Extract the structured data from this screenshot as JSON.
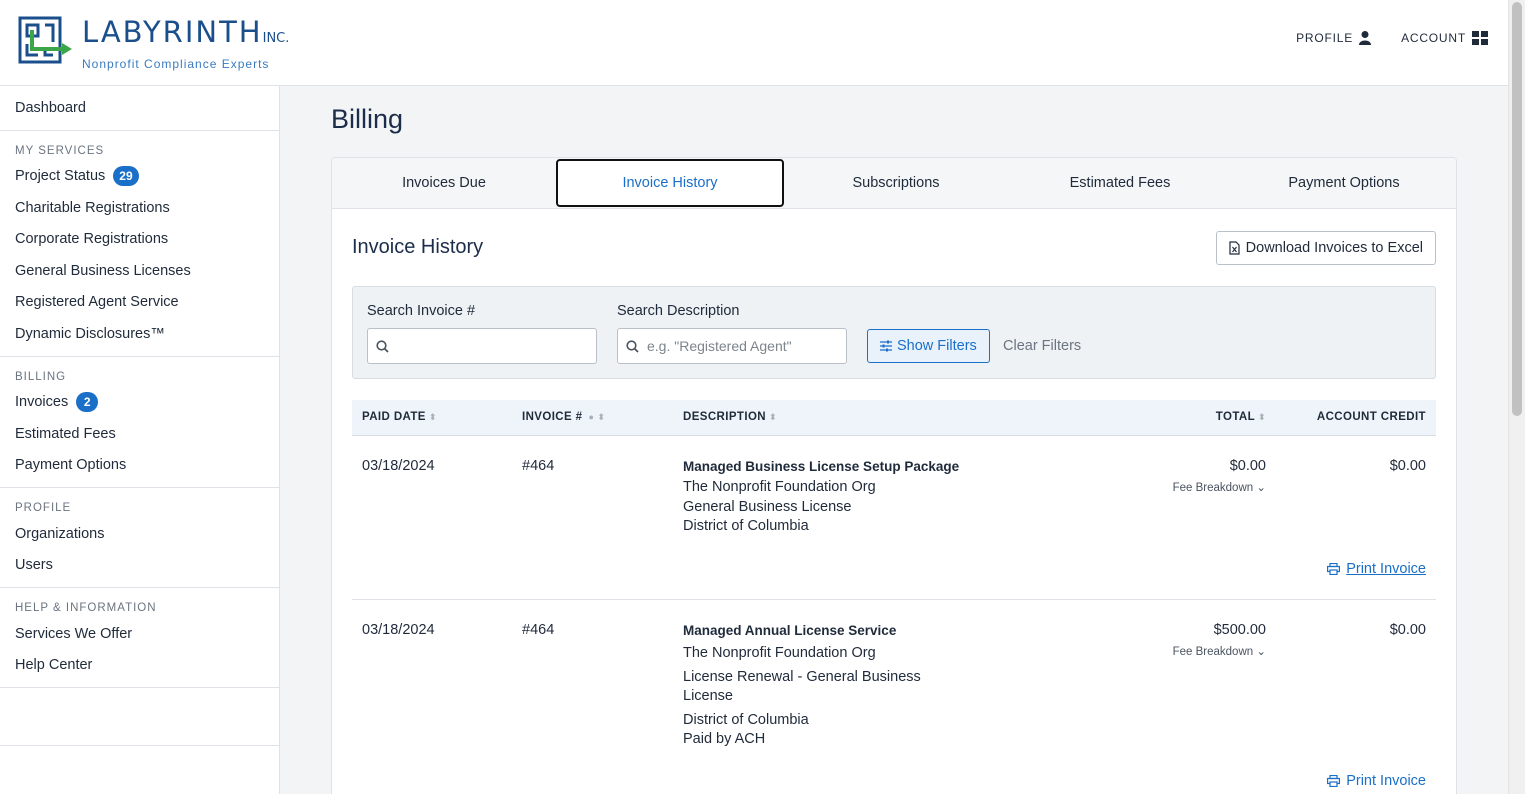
{
  "brand": {
    "name": "LABYRINTH",
    "suffix": "INC.",
    "tagline": "Nonprofit Compliance Experts",
    "colors": {
      "primary": "#1b4f8c",
      "accent": "#3a7bbf",
      "green": "#3ba54a"
    }
  },
  "header": {
    "profile_label": "PROFILE",
    "account_label": "ACCOUNT"
  },
  "sidebar": {
    "dashboard": "Dashboard",
    "sections": [
      {
        "heading": "MY SERVICES",
        "items": [
          {
            "label": "Project Status",
            "badge": "29"
          },
          {
            "label": "Charitable Registrations"
          },
          {
            "label": "Corporate Registrations"
          },
          {
            "label": "General Business Licenses"
          },
          {
            "label": "Registered Agent Service"
          },
          {
            "label": "Dynamic Disclosures™"
          }
        ]
      },
      {
        "heading": "BILLING",
        "items": [
          {
            "label": "Invoices",
            "badge": "2"
          },
          {
            "label": "Estimated Fees"
          },
          {
            "label": "Payment Options"
          }
        ]
      },
      {
        "heading": "PROFILE",
        "items": [
          {
            "label": "Organizations"
          },
          {
            "label": "Users"
          }
        ]
      },
      {
        "heading": "HELP & INFORMATION",
        "items": [
          {
            "label": "Services We Offer"
          },
          {
            "label": "Help Center"
          }
        ]
      }
    ]
  },
  "main": {
    "title": "Billing",
    "tabs": [
      {
        "label": "Invoices Due"
      },
      {
        "label": "Invoice History",
        "active": true
      },
      {
        "label": "Subscriptions"
      },
      {
        "label": "Estimated Fees"
      },
      {
        "label": "Payment Options"
      }
    ],
    "section_title": "Invoice History",
    "download_label": "Download Invoices to Excel",
    "filters": {
      "invoice_label": "Search Invoice #",
      "invoice_value": "",
      "description_label": "Search Description",
      "description_placeholder": "e.g. \"Registered Agent\"",
      "show_filters": "Show Filters",
      "clear_filters": "Clear Filters"
    },
    "table": {
      "columns": {
        "paid_date": "PAID DATE",
        "invoice": "INVOICE #",
        "description": "DESCRIPTION",
        "total": "TOTAL",
        "account_credit": "ACCOUNT CREDIT"
      },
      "rows": [
        {
          "paid_date": "03/18/2024",
          "invoice": "#464",
          "desc_title": "Managed Business License Setup Package",
          "desc_lines": [
            "The Nonprofit Foundation Org",
            "General Business License",
            "District of Columbia"
          ],
          "total": "$0.00",
          "fee_breakdown": "Fee Breakdown",
          "account_credit": "$0.00",
          "print_label": "Print Invoice"
        },
        {
          "paid_date": "03/18/2024",
          "invoice": "#464",
          "desc_title": "Managed Annual License Service",
          "desc_lines": [
            "The Nonprofit Foundation Org",
            "License Renewal - General Business",
            "License",
            "District of Columbia",
            "Paid by ACH"
          ],
          "total": "$500.00",
          "fee_breakdown": "Fee Breakdown",
          "account_credit": "$0.00",
          "print_label": "Print Invoice"
        }
      ]
    }
  }
}
